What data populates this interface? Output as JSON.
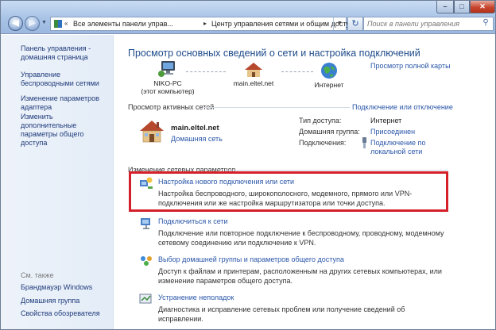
{
  "address": {
    "segments": [
      "Все элементы панели управ...",
      "Центр управления сетями и общим доступом"
    ],
    "search_placeholder": "Поиск в панели управления"
  },
  "sidebar": {
    "links": [
      {
        "label": "Панель управления - домашняя страница"
      },
      {
        "label": "Управление беспроводными сетями"
      },
      {
        "label": "Изменение параметров адаптера"
      },
      {
        "label": "Изменить дополнительные параметры общего доступа"
      }
    ],
    "see_also_label": "См. также",
    "see_also": [
      {
        "label": "Брандмауэр Windows"
      },
      {
        "label": "Домашняя группа"
      },
      {
        "label": "Свойства обозревателя"
      }
    ]
  },
  "main": {
    "title": "Просмотр основных сведений о сети и настройка подключений",
    "full_map_link": "Просмотр полной карты",
    "map": {
      "computer_name": "NIKO-PC",
      "computer_sub": "(этот компьютер)",
      "network_name": "main.eltel.net",
      "internet_label": "Интернет"
    },
    "active": {
      "header": "Просмотр активных сетей",
      "connect_link": "Подключение или отключение",
      "network_name": "main.eltel.net",
      "network_type": "Домашняя сеть",
      "access_type_label": "Тип доступа:",
      "access_type_value": "Интернет",
      "homegroup_label": "Домашняя группа:",
      "homegroup_value": "Присоединен",
      "connections_label": "Подключения:",
      "connections_value": "Подключение по локальной сети"
    },
    "change": {
      "header": "Изменение сетевых параметров",
      "tasks": [
        {
          "title": "Настройка нового подключения или сети",
          "desc": "Настройка беспроводного, широкополосного, модемного, прямого или VPN-подключения или же настройка маршрутизатора или точки доступа."
        },
        {
          "title": "Подключиться к сети",
          "desc": "Подключение или повторное подключение к беспроводному, проводному, модемному сетевому соединению или подключение к VPN."
        },
        {
          "title": "Выбор домашней группы и параметров общего доступа",
          "desc": "Доступ к файлам и принтерам, расположенным на других сетевых компьютерах, или изменение параметров общего доступа."
        },
        {
          "title": "Устранение неполадок",
          "desc": "Диагностика и исправление сетевых проблем или получение сведений об исправлении."
        }
      ]
    }
  },
  "colors": {
    "highlight_border": "#d4202a",
    "link": "#2a56a8",
    "title": "#1d4a8a"
  }
}
